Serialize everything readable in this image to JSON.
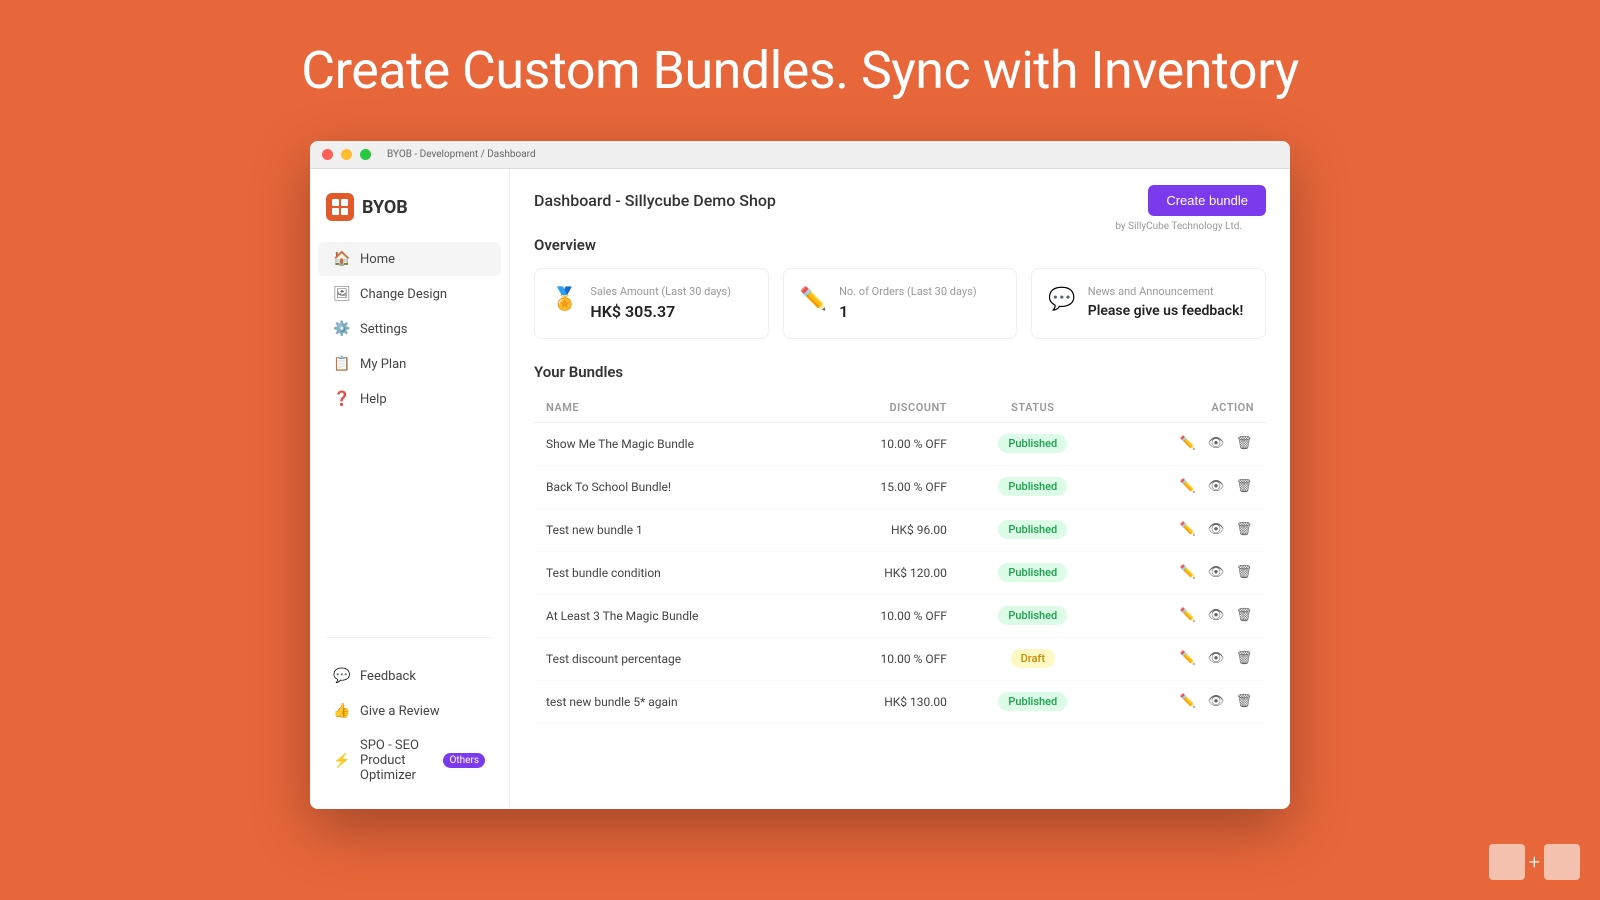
{
  "hero": {
    "title": "Create Custom Bundles. Sync with Inventory"
  },
  "browser": {
    "breadcrumb": "BYOB - Development / Dashboard",
    "by_label": "by SillyCube Technology Ltd."
  },
  "sidebar": {
    "logo_text": "BYOB",
    "nav_items": [
      {
        "id": "home",
        "label": "Home",
        "icon": "🏠"
      },
      {
        "id": "change-design",
        "label": "Change Design",
        "icon": "🖼"
      },
      {
        "id": "settings",
        "label": "Settings",
        "icon": "⚙️"
      },
      {
        "id": "my-plan",
        "label": "My Plan",
        "icon": "📋"
      },
      {
        "id": "help",
        "label": "Help",
        "icon": "❓"
      }
    ],
    "bottom_items": [
      {
        "id": "feedback",
        "label": "Feedback",
        "icon": "💬"
      },
      {
        "id": "give-review",
        "label": "Give a Review",
        "icon": "👍"
      },
      {
        "id": "spo",
        "label": "SPO - SEO Product Optimizer",
        "icon": "⚡",
        "badge": "Others"
      }
    ]
  },
  "page": {
    "title": "Dashboard - Sillycube Demo Shop",
    "create_bundle_label": "Create bundle"
  },
  "overview": {
    "section_title": "Overview",
    "cards": [
      {
        "icon": "🏅",
        "label": "Sales Amount (Last 30 days)",
        "value": "HK$ 305.37"
      },
      {
        "icon": "✏️",
        "label": "No. of Orders (Last 30 days)",
        "value": "1"
      },
      {
        "icon": "💬",
        "label": "News and Announcement",
        "value": "Please give us feedback!"
      }
    ]
  },
  "bundles": {
    "section_title": "Your Bundles",
    "columns": {
      "name": "NAME",
      "discount": "DISCOUNT",
      "status": "STATUS",
      "action": "ACTION"
    },
    "rows": [
      {
        "name": "Show Me The Magic Bundle",
        "discount": "10.00 % OFF",
        "status": "Published"
      },
      {
        "name": "Back To School Bundle!",
        "discount": "15.00 % OFF",
        "status": "Published"
      },
      {
        "name": "Test new bundle 1",
        "discount": "HK$ 96.00",
        "status": "Published"
      },
      {
        "name": "Test bundle condition",
        "discount": "HK$ 120.00",
        "status": "Published"
      },
      {
        "name": "At Least 3 The Magic Bundle",
        "discount": "10.00 % OFF",
        "status": "Published"
      },
      {
        "name": "Test discount percentage",
        "discount": "10.00 % OFF",
        "status": "Draft"
      },
      {
        "name": "test new bundle 5* again",
        "discount": "HK$ 130.00",
        "status": "Published"
      }
    ]
  },
  "decoration": {
    "plus_symbol": "+"
  }
}
